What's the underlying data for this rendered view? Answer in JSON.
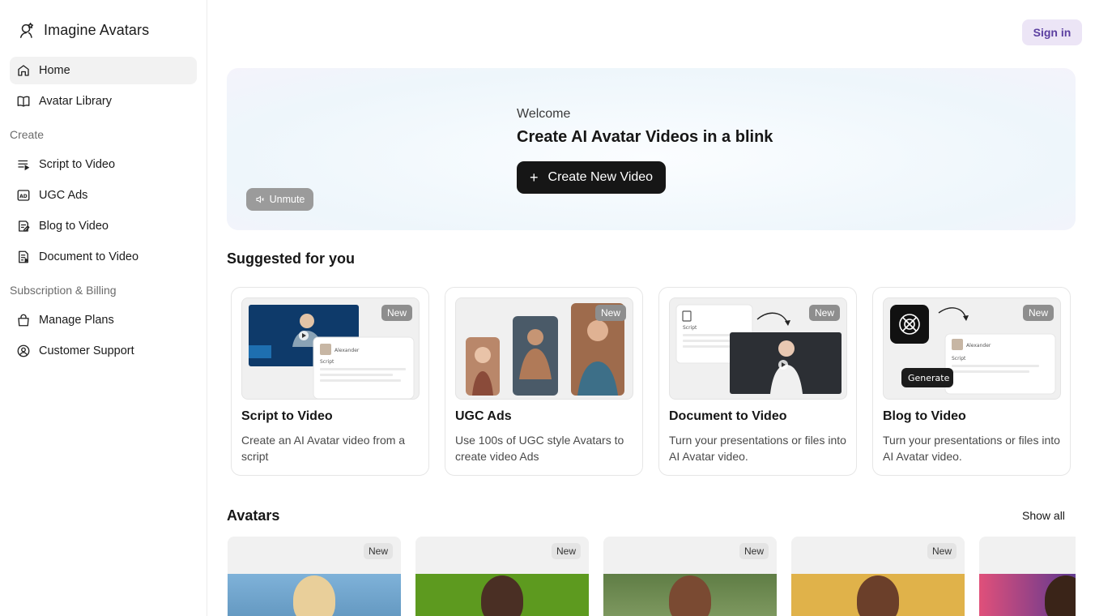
{
  "brand": {
    "title": "Imagine Avatars"
  },
  "sidebar": {
    "top": [
      {
        "label": "Home",
        "icon": "home-icon"
      },
      {
        "label": "Avatar Library",
        "icon": "book-icon"
      }
    ],
    "create_label": "Create",
    "create": [
      {
        "label": "Script to Video",
        "icon": "script-icon"
      },
      {
        "label": "UGC Ads",
        "icon": "ad-icon"
      },
      {
        "label": "Blog to Video",
        "icon": "blog-icon"
      },
      {
        "label": "Document to Video",
        "icon": "document-icon"
      }
    ],
    "billing_label": "Subscription & Billing",
    "billing": [
      {
        "label": "Manage Plans",
        "icon": "bag-icon"
      },
      {
        "label": "Customer Support",
        "icon": "support-icon"
      }
    ]
  },
  "header": {
    "signin": "Sign in"
  },
  "hero": {
    "unmute": "Unmute",
    "welcome": "Welcome",
    "title": "Create AI Avatar Videos in a blink",
    "create_button": "Create New Video"
  },
  "suggested": {
    "heading": "Suggested for you",
    "cards": [
      {
        "title": "Script to Video",
        "desc": "Create an AI Avatar video from a script",
        "badge": "New",
        "thumb_name": "Alexander",
        "thumb_label": "Script"
      },
      {
        "title": "UGC Ads",
        "desc": "Use 100s of UGC style Avatars to create video Ads",
        "badge": "New"
      },
      {
        "title": "Document to Video",
        "desc": "Turn your presentations or files into AI Avatar video.",
        "badge": "New",
        "thumb_label": "Script"
      },
      {
        "title": "Blog to Video",
        "desc": "Turn your presentations or files into AI Avatar video.",
        "badge": "New",
        "thumb_name": "Alexander",
        "thumb_label": "Script",
        "thumb_button": "Generate"
      }
    ]
  },
  "avatars": {
    "heading": "Avatars",
    "show_all": "Show all",
    "items": [
      {
        "badge": "New",
        "bg": "#6fa0c8"
      },
      {
        "badge": "New",
        "bg": "#5d9a1f"
      },
      {
        "badge": "New",
        "bg": "#6c8a4f"
      },
      {
        "badge": "New",
        "bg": "#e0b24a"
      },
      {
        "badge": "",
        "bg": "#7a3a6e"
      }
    ]
  }
}
